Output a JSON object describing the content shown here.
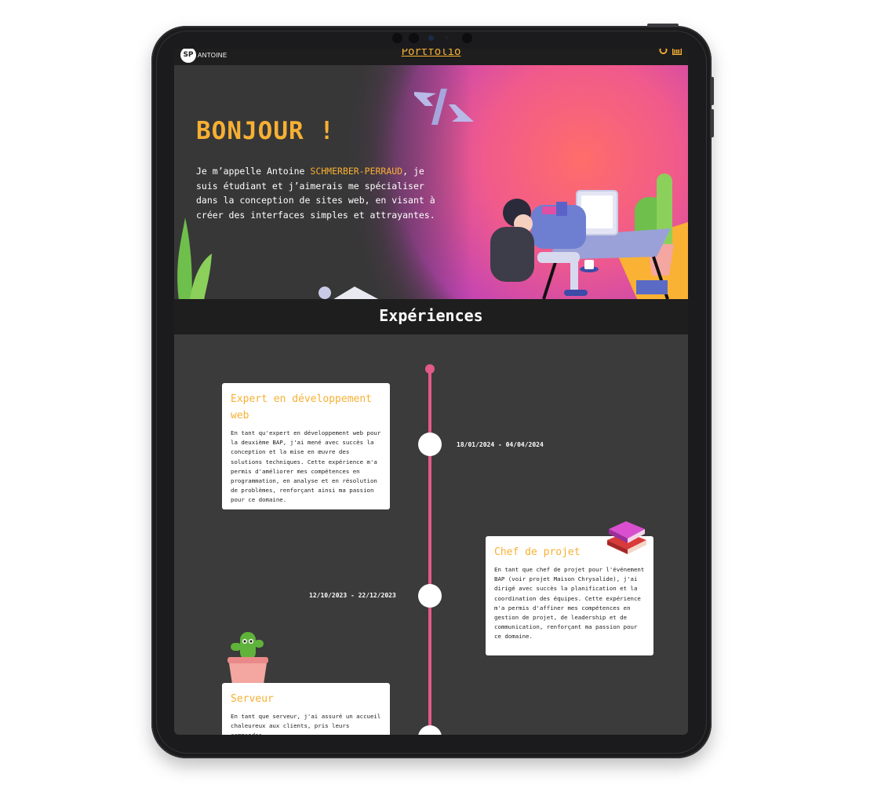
{
  "nav": {
    "logo_text": "ANTOINE",
    "title": "Portfolio",
    "icons": [
      "github-icon",
      "linkedin-icon"
    ]
  },
  "hero": {
    "heading": "BONJOUR !",
    "intro_before": "Je m’appelle Antoine ",
    "intro_name": "SCHMERBER-PERRAUD",
    "intro_after": ", je suis étudiant et j’aimerais me spécialiser dans la conception de sites web, en visant à créer des interfaces simples et attrayantes."
  },
  "section": {
    "title": "Expériences"
  },
  "experiences": [
    {
      "title": "Expert en développement web",
      "date": "18/01/2024 - 04/04/2024",
      "text": "En tant qu'expert en développement web pour la deuxième BAP, j'ai mené avec succès la conception et la mise en œuvre des solutions techniques. Cette expérience m'a permis d'améliorer mes compétences en programmation, en analyse et en résolution de problèmes, renforçant ainsi ma passion pour ce domaine."
    },
    {
      "title": "Chef de projet",
      "date": "12/10/2023 - 22/12/2023",
      "text": "En tant que chef de projet pour l'événement BAP (voir projet Maison Chrysalide), j'ai dirigé avec succès la planification et la coordination des équipes. Cette expérience m'a permis d'affiner mes compétences en gestion de projet, de leadership et de communication, renforçant ma passion pour ce domaine."
    },
    {
      "title": "Serveur",
      "date": "",
      "text": "En tant que serveur, j'ai assuré un accueil chaleureux aux clients, pris leurs commandes"
    }
  ],
  "colors": {
    "accent": "#f7b033",
    "timeline": "#e35a8a",
    "background": "#3b3b3b",
    "bar": "#1e1e1e"
  }
}
